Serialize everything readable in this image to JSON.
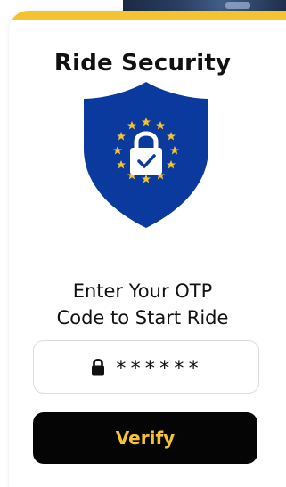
{
  "modal": {
    "title": "Ride Security",
    "shield_icon": "eu-security-shield-icon",
    "prompt_line1": "Enter Your OTP",
    "prompt_line2": "Code to Start Ride",
    "otp": {
      "lock_icon": "lock-icon",
      "value": "******"
    },
    "verify_label": "Verify"
  },
  "colors": {
    "accent_yellow": "#F4C430",
    "shield_blue": "#0B3A9E",
    "button_black": "#050505",
    "text_dark": "#111111"
  }
}
